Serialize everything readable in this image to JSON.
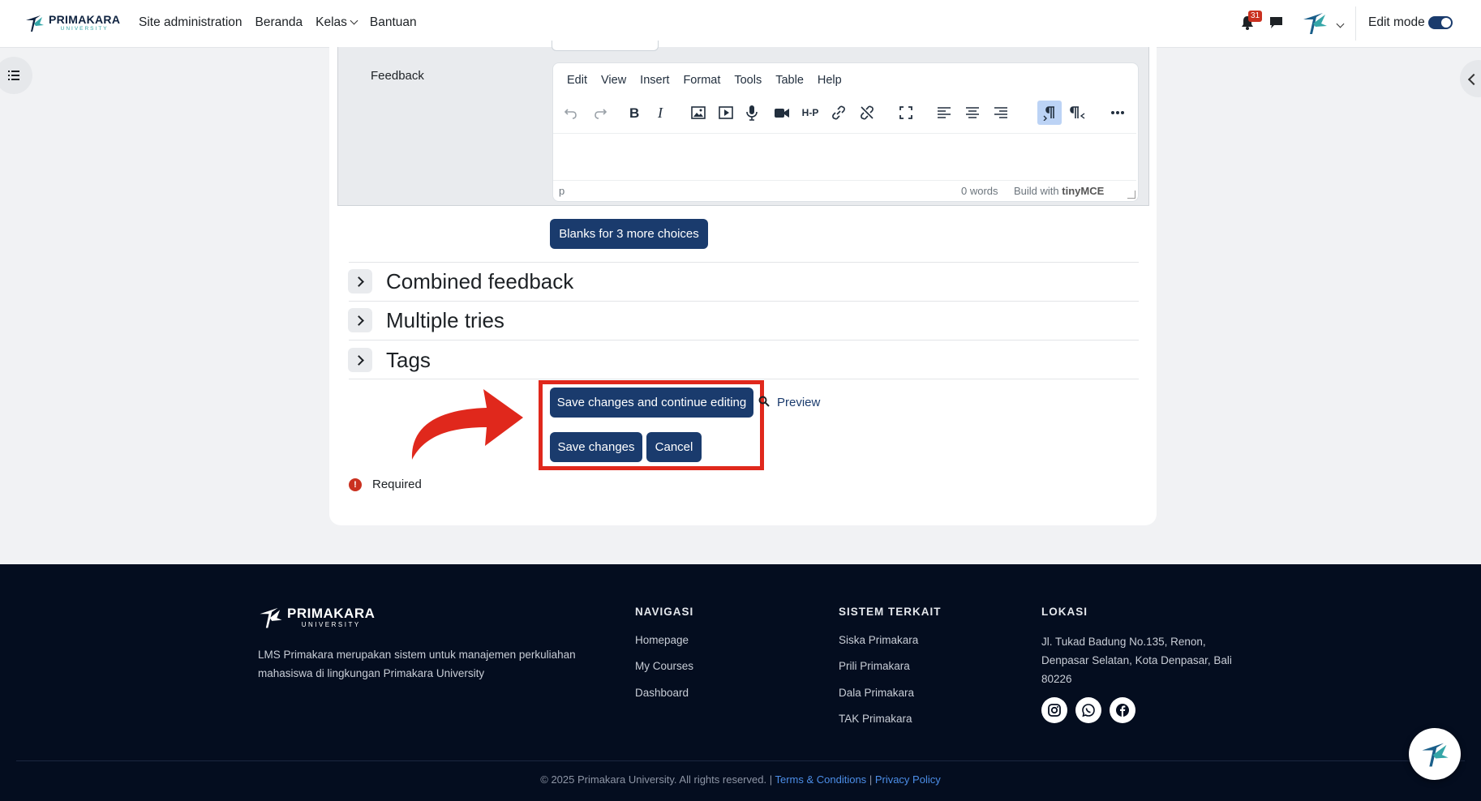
{
  "navbar": {
    "brand": "PRIMAKARA",
    "brand_sub": "UNIVERSITY",
    "links": [
      "Site administration",
      "Beranda",
      "Kelas",
      "Bantuan"
    ],
    "notification_count": "31",
    "edit_mode_label": "Edit mode",
    "edit_mode_on": true
  },
  "form": {
    "feedback_label": "Feedback",
    "editor": {
      "menu": [
        "Edit",
        "View",
        "Insert",
        "Format",
        "Tools",
        "Table",
        "Help"
      ],
      "toolbar_icons": [
        "undo-icon",
        "redo-icon",
        "bold-icon",
        "italic-icon",
        "image-icon",
        "media-icon",
        "record-audio-icon",
        "record-video-icon",
        "h5p-icon",
        "link-icon",
        "unlink-icon",
        "fullscreen-icon",
        "align-left-icon",
        "align-center-icon",
        "align-right-icon",
        "ltr-icon",
        "rtl-icon",
        "more-icon"
      ],
      "h5p_label": "H-P",
      "status_path": "p",
      "word_count": "0 words",
      "build_with": "Build with",
      "build_brand": "tinyMCE"
    },
    "blanks_button": "Blanks for 3 more choices",
    "sections": [
      "Combined feedback",
      "Multiple tries",
      "Tags"
    ],
    "save_continue": "Save changes and continue editing",
    "preview": "Preview",
    "save": "Save changes",
    "cancel": "Cancel",
    "required": "Required"
  },
  "footer": {
    "brand": "PRIMAKARA",
    "brand_sub": "UNIVERSITY",
    "description": "LMS Primakara merupakan sistem untuk manajemen perkuliahan mahasiswa di lingkungan Primakara University",
    "nav_title": "NAVIGASI",
    "nav_links": [
      "Homepage",
      "My Courses",
      "Dashboard"
    ],
    "related_title": "SISTEM TERKAIT",
    "related_links": [
      "Siska Primakara",
      "Prili Primakara",
      "Dala Primakara",
      "TAK Primakara"
    ],
    "location_title": "LOKASI",
    "address": "Jl. Tukad Badung No.135, Renon, Denpasar Selatan, Kota Denpasar, Bali 80226",
    "social": [
      "instagram-icon",
      "whatsapp-icon",
      "facebook-icon"
    ],
    "copyright": "© 2025 Primakara University. All rights reserved.",
    "terms": "Terms & Conditions",
    "privacy": "Privacy Policy"
  },
  "colors": {
    "primary": "#1a3b6d",
    "highlight": "#e0281c",
    "footer_bg": "#040d1f"
  }
}
